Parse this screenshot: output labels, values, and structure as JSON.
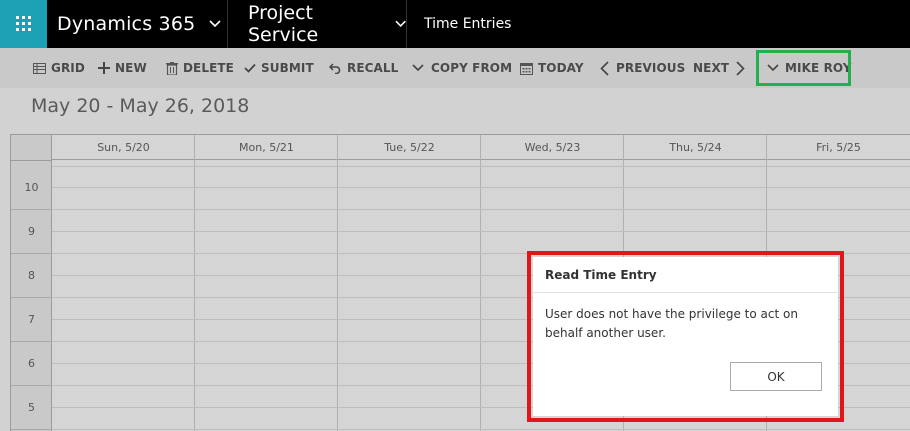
{
  "nav": {
    "app_name": "Dynamics 365",
    "area_name": "Project Service",
    "breadcrumb": "Time Entries"
  },
  "commands": {
    "grid": "GRID",
    "new": "NEW",
    "delete": "DELETE",
    "submit": "SUBMIT",
    "recall": "RECALL",
    "copy_from": "COPY FROM",
    "today": "TODAY",
    "previous": "PREVIOUS",
    "next": "NEXT",
    "user": "MIKE ROY"
  },
  "calendar": {
    "date_range": "May 20 - May 26, 2018",
    "days": [
      "Sun, 5/20",
      "Mon, 5/21",
      "Tue, 5/22",
      "Wed, 5/23",
      "Thu, 5/24",
      "Fri, 5/25"
    ],
    "hours": [
      "10",
      "9",
      "8",
      "7",
      "6",
      "5"
    ]
  },
  "dialog": {
    "title": "Read Time Entry",
    "message": "User does not have the privilege to act on behalf another user.",
    "ok_label": "OK"
  },
  "colors": {
    "waffle": "#1ba1b3",
    "topbar": "#000000",
    "highlight_green": "#22b14c",
    "highlight_red": "#e0151d"
  },
  "icons": {
    "waffle": "waffle-icon",
    "grid": "grid-icon",
    "new": "plus-icon",
    "delete": "trash-icon",
    "submit": "check-icon",
    "recall": "undo-icon",
    "copy_from": "chevron-down-icon",
    "today": "calendar-icon",
    "previous": "chevron-left-icon",
    "next": "chevron-right-icon",
    "user": "chevron-down-icon"
  }
}
